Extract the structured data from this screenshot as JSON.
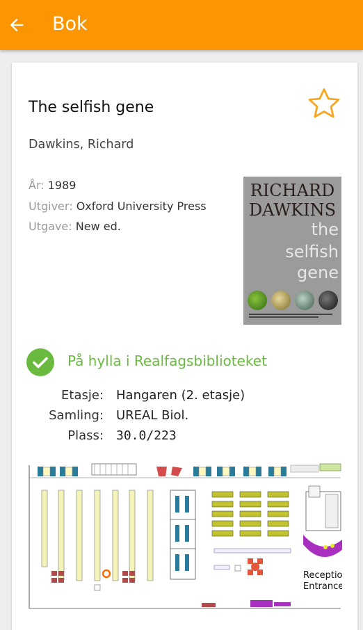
{
  "appbar": {
    "title": "Bok"
  },
  "book": {
    "title": "The selfish gene",
    "author": "Dawkins, Richard",
    "meta": [
      {
        "label": "År:",
        "value": "1989"
      },
      {
        "label": "Utgiver:",
        "value": "Oxford University Press"
      },
      {
        "label": "Utgave:",
        "value": "New ed."
      }
    ],
    "cover": {
      "author_line1": "RICHARD",
      "author_line2": "DAWKINS",
      "title_line1": "the",
      "title_line2": "selfish",
      "title_line3": "gene"
    }
  },
  "availability": {
    "status": "På hylla i Realfagsbiblioteket",
    "color": "#6aba3f"
  },
  "location": {
    "rows": [
      {
        "label": "Etasje:",
        "value": "Hangaren (2. etasje)"
      },
      {
        "label": "Samling:",
        "value": "UREAL Biol."
      },
      {
        "label": "Plass:",
        "value": "30.0/223"
      }
    ]
  },
  "map": {
    "reception_line1": "Reception /",
    "reception_line2": "Entrance"
  },
  "colors": {
    "accent": "#fb9602",
    "star": "#f5a623"
  }
}
